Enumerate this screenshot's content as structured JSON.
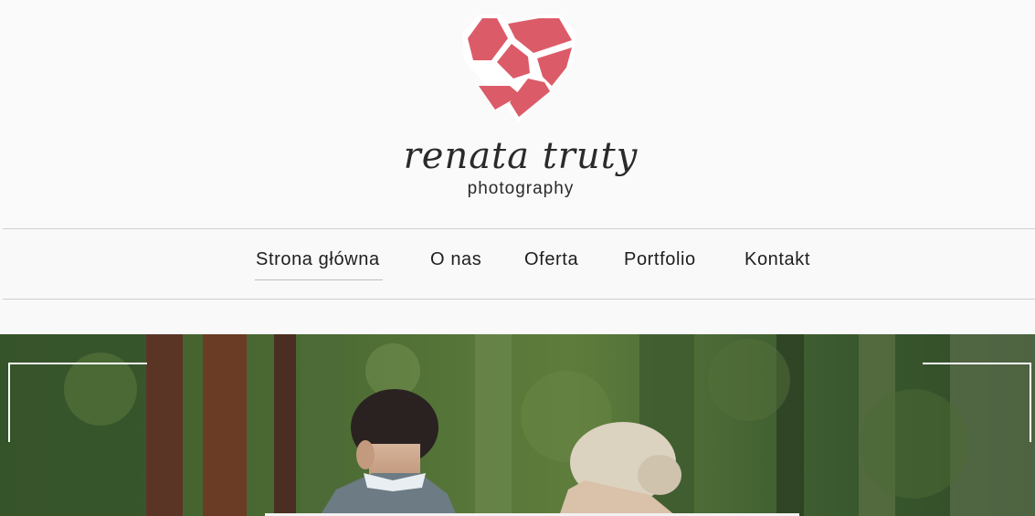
{
  "brand": {
    "name": "renata truty",
    "tagline": "photography",
    "logo_color": "#dc5b68"
  },
  "nav": {
    "items": [
      {
        "label": "Strona główna",
        "active": true
      },
      {
        "label": "O nas",
        "active": false
      },
      {
        "label": "Oferta",
        "active": false
      },
      {
        "label": "Portfolio",
        "active": false
      },
      {
        "label": "Kontakt",
        "active": false
      }
    ]
  },
  "hero": {
    "description": "",
    "frame_color": "#ffffff"
  }
}
